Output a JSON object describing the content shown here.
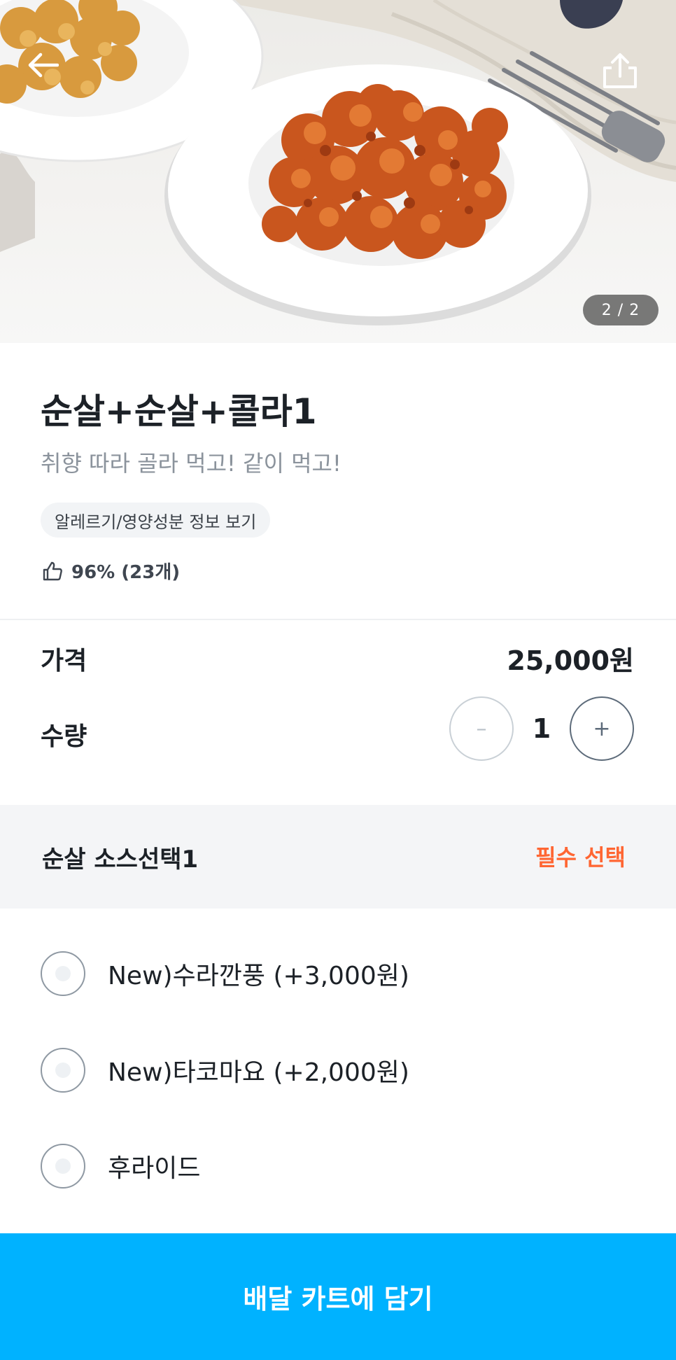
{
  "hero": {
    "page_indicator": "2 / 2",
    "back_icon": "arrow-left-icon",
    "share_icon": "share-icon"
  },
  "product": {
    "name": "순살+순살+콜라1",
    "description": "취향 따라 골라 먹고! 같이 먹고!",
    "allergy_link": "알레르기/영양성분 정보 보기",
    "rating_icon": "thumbs-up-icon",
    "rating_text": "96% (23개)"
  },
  "order": {
    "price_label": "가격",
    "price_value": "25,000원",
    "quantity_label": "수량",
    "quantity_value": "1",
    "minus_label": "–",
    "plus_label": "+"
  },
  "option_group": {
    "title": "순살 소스선택1",
    "badge": "필수 선택",
    "options": [
      {
        "label": "New)수라깐풍 (+3,000원)"
      },
      {
        "label": "New)타코마요 (+2,000원)"
      },
      {
        "label": "후라이드"
      }
    ]
  },
  "cta": {
    "label": "배달 카트에 담기"
  },
  "colors": {
    "accent": "#00b2ff",
    "required": "#ff6633",
    "text_primary": "#1c2127",
    "text_secondary": "#8b939c"
  }
}
